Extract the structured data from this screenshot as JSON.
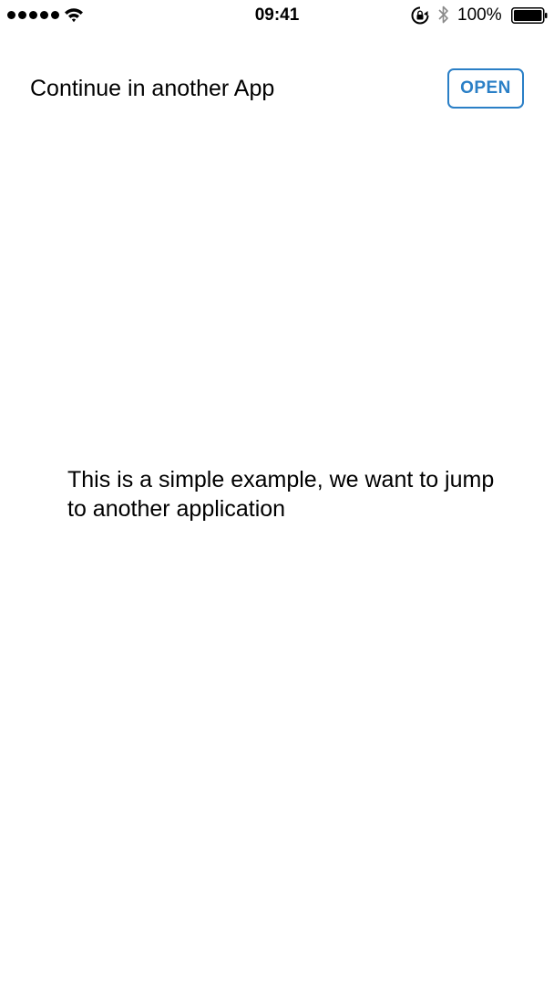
{
  "status_bar": {
    "signal_dots": 5,
    "wifi_icon": "wifi-icon",
    "time": "09:41",
    "rotation_lock_icon": "rotation-lock-icon",
    "bluetooth_icon": "bluetooth-icon",
    "battery_percent": "100%",
    "battery_level": 1.0
  },
  "header": {
    "title": "Continue in another App",
    "open_label": "OPEN"
  },
  "main": {
    "message": "This is a simple example, we want to jump to another application"
  },
  "colors": {
    "accent": "#2a7fc6",
    "text": "#000000",
    "background": "#ffffff"
  }
}
